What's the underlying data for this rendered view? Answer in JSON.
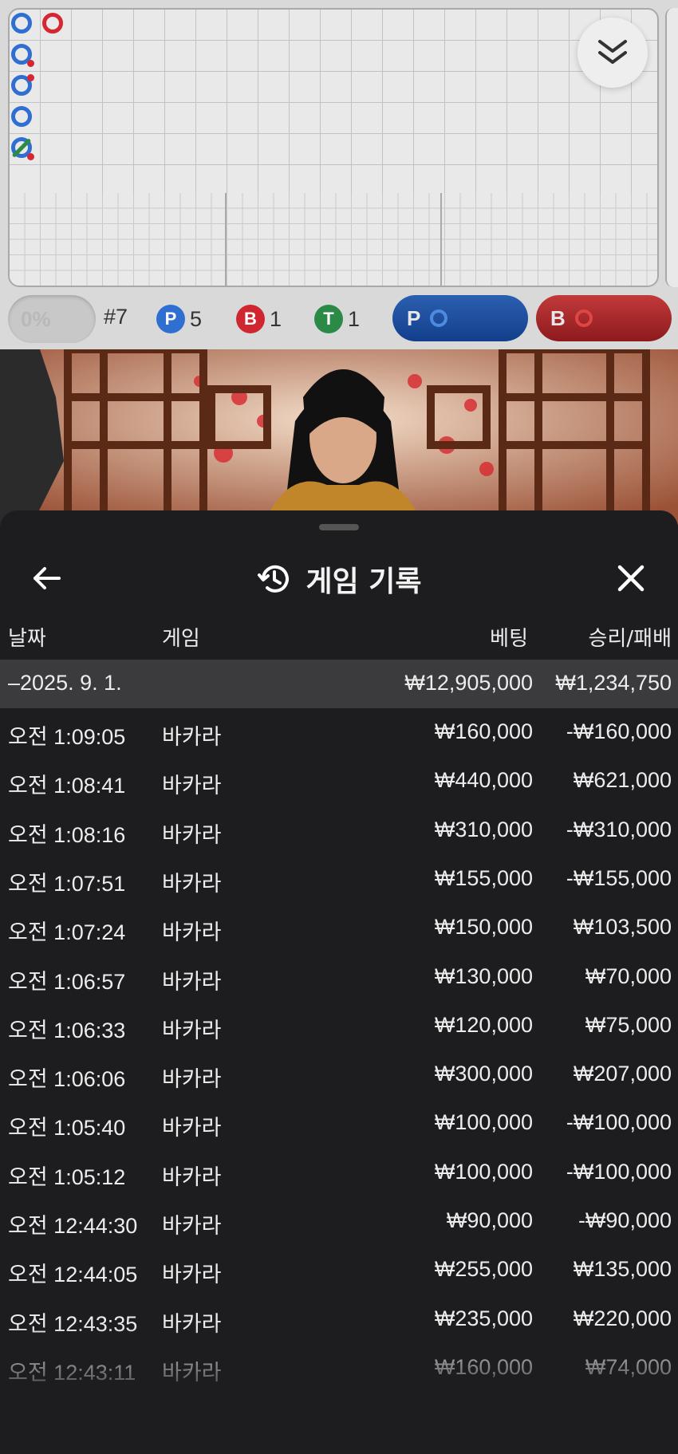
{
  "roadmap": {
    "shoe_label": "#7",
    "progress_label": "0%",
    "stats": [
      {
        "letter": "P",
        "count": "5",
        "color": "#2f6fd1"
      },
      {
        "letter": "B",
        "count": "1",
        "color": "#d0262f"
      },
      {
        "letter": "T",
        "count": "1",
        "color": "#2a8a46"
      }
    ],
    "bet_player_label": "P",
    "bet_banker_label": "B",
    "colors": {
      "player": "#2f6fd1",
      "banker": "#d62631",
      "tie": "#2e8b3f"
    }
  },
  "history": {
    "title": "게임 기록",
    "columns": {
      "date": "날짜",
      "game": "게임",
      "bet": "베팅",
      "result": "승리/패배"
    },
    "summary": {
      "date": "–2025. 9. 1.",
      "bet": "₩12,905,000",
      "result": "₩1,234,750"
    },
    "rows": [
      {
        "time": "오전 1:09:05",
        "game": "바카라",
        "bet": "₩160,000",
        "result": "-₩160,000"
      },
      {
        "time": "오전 1:08:41",
        "game": "바카라",
        "bet": "₩440,000",
        "result": "₩621,000"
      },
      {
        "time": "오전 1:08:16",
        "game": "바카라",
        "bet": "₩310,000",
        "result": "-₩310,000"
      },
      {
        "time": "오전 1:07:51",
        "game": "바카라",
        "bet": "₩155,000",
        "result": "-₩155,000"
      },
      {
        "time": "오전 1:07:24",
        "game": "바카라",
        "bet": "₩150,000",
        "result": "₩103,500"
      },
      {
        "time": "오전 1:06:57",
        "game": "바카라",
        "bet": "₩130,000",
        "result": "₩70,000"
      },
      {
        "time": "오전 1:06:33",
        "game": "바카라",
        "bet": "₩120,000",
        "result": "₩75,000"
      },
      {
        "time": "오전 1:06:06",
        "game": "바카라",
        "bet": "₩300,000",
        "result": "₩207,000"
      },
      {
        "time": "오전 1:05:40",
        "game": "바카라",
        "bet": "₩100,000",
        "result": "-₩100,000"
      },
      {
        "time": "오전 1:05:12",
        "game": "바카라",
        "bet": "₩100,000",
        "result": "-₩100,000"
      },
      {
        "time": "오전 12:44:30",
        "game": "바카라",
        "bet": "₩90,000",
        "result": "-₩90,000"
      },
      {
        "time": "오전 12:44:05",
        "game": "바카라",
        "bet": "₩255,000",
        "result": "₩135,000"
      },
      {
        "time": "오전 12:43:35",
        "game": "바카라",
        "bet": "₩235,000",
        "result": "₩220,000"
      },
      {
        "time": "오전 12:43:11",
        "game": "바카라",
        "bet": "₩160,000",
        "result": "₩74,000"
      }
    ]
  }
}
